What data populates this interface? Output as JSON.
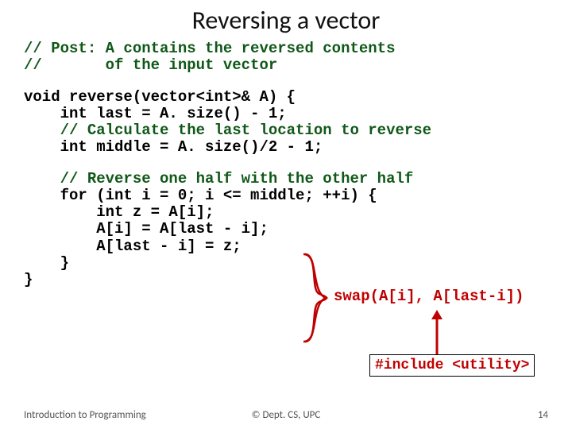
{
  "title": "Reversing a vector",
  "post_comment_line1": "// Post: A contains the reversed contents",
  "post_comment_line2": "//       of the input vector",
  "code": {
    "l1": "void reverse(vector<int>& A) {",
    "l2": "    int last = A. size() - 1;",
    "l3_cmt": "    // Calculate the last location to reverse",
    "l4": "    int middle = A. size()/2 - 1;"
  },
  "code2": {
    "l1_cmt": "    // Reverse one half with the other half",
    "l2": "    for (int i = 0; i <= middle; ++i) {",
    "l3": "        int z = A[i];",
    "l4": "        A[i] = A[last - i];",
    "l5": "        A[last - i] = z;",
    "l6": "    }",
    "l7": "}"
  },
  "swap_call": "swap(A[i], A[last-i])",
  "include": "#include <utility>",
  "footer": {
    "left": "Introduction to Programming",
    "center": "© Dept. CS, UPC",
    "right": "14"
  },
  "colors": {
    "comment_green": "#105818",
    "red": "#c00000"
  }
}
